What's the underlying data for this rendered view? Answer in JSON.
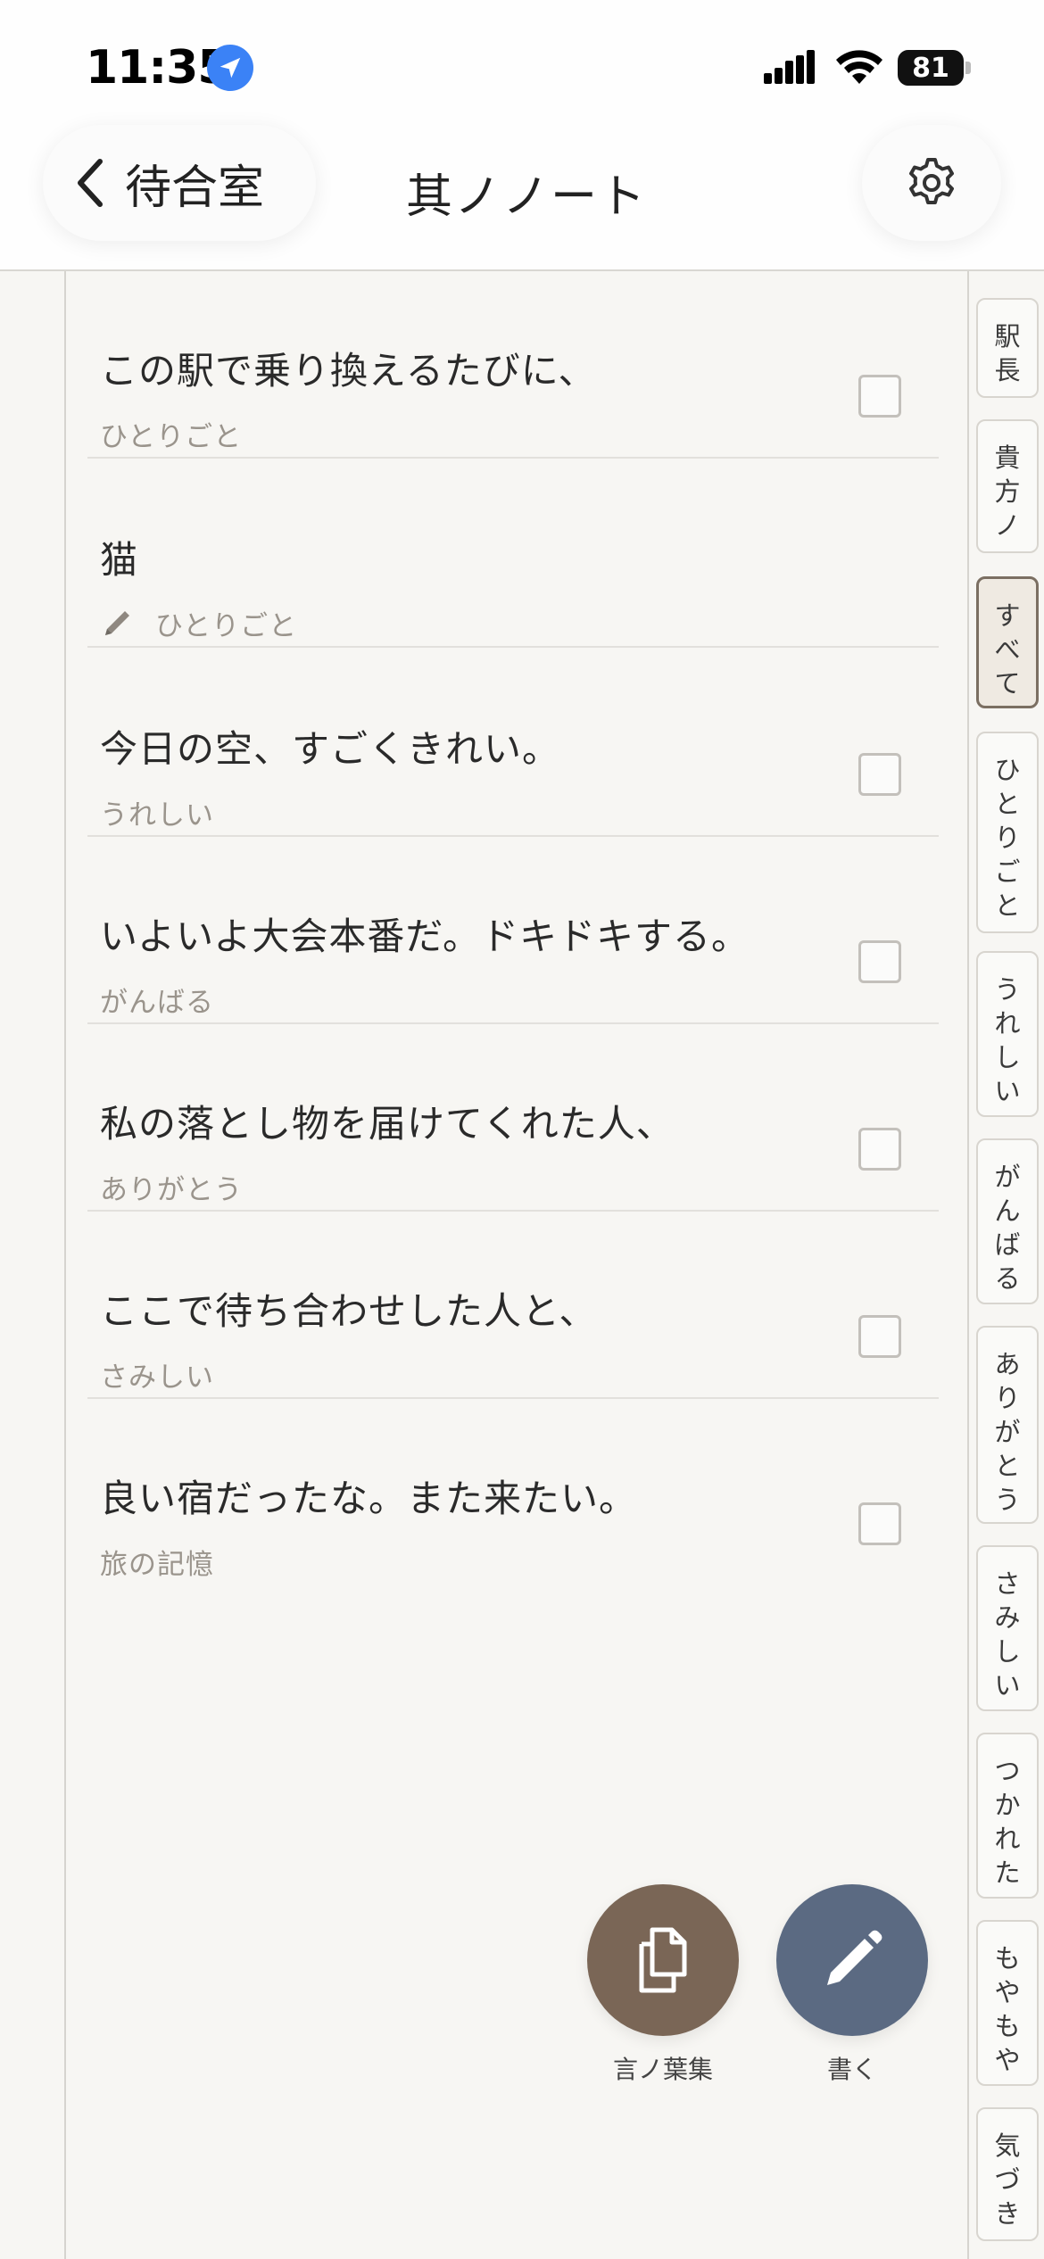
{
  "status_bar": {
    "time": "11:35",
    "battery": "81",
    "icons": [
      "location-arrow-icon",
      "cellular-signal-icon",
      "wifi-icon",
      "battery-icon"
    ]
  },
  "header": {
    "back_label": "待合室",
    "title": "其ノノート",
    "settings_icon": "gear-icon"
  },
  "notes": [
    {
      "text": "この駅で乗り換えるたびに、",
      "tag": "ひとりごと",
      "checked": false
    },
    {
      "text": "猫",
      "tag": "ひとりごと",
      "editing": true
    },
    {
      "text": "今日の空、すごくきれい。",
      "tag": "うれしい",
      "checked": false
    },
    {
      "text": "いよいよ大会本番だ。ドキドキする。",
      "tag": "がんばる",
      "checked": false
    },
    {
      "text": "私の落とし物を届けてくれた人、",
      "tag": "ありがとう",
      "checked": false
    },
    {
      "text": "ここで待ち合わせした人と、",
      "tag": "さみしい",
      "checked": false
    },
    {
      "text": "良い宿だったな。また来たい。",
      "tag": "旅の記憶",
      "checked": false
    }
  ],
  "side_tabs": [
    {
      "label": "駅長",
      "active": false
    },
    {
      "label": "貴方ノ",
      "active": false
    },
    {
      "label": "すべて",
      "active": true
    },
    {
      "label": "ひとりごと",
      "active": false
    },
    {
      "label": "うれしい",
      "active": false
    },
    {
      "label": "がんばる",
      "active": false
    },
    {
      "label": "ありがとう",
      "active": false
    },
    {
      "label": "さみしい",
      "active": false
    },
    {
      "label": "つかれた",
      "active": false
    },
    {
      "label": "もやもや",
      "active": false
    },
    {
      "label": "気づき",
      "active": false
    }
  ],
  "actions": {
    "collect_label": "言ノ葉集",
    "write_label": "書く"
  },
  "colors": {
    "background": "#f7f6f3",
    "collect_fab": "#7a6656",
    "write_fab": "#5b6a82",
    "active_tab_border": "#7b6f62",
    "tag_text": "#9a948c"
  }
}
